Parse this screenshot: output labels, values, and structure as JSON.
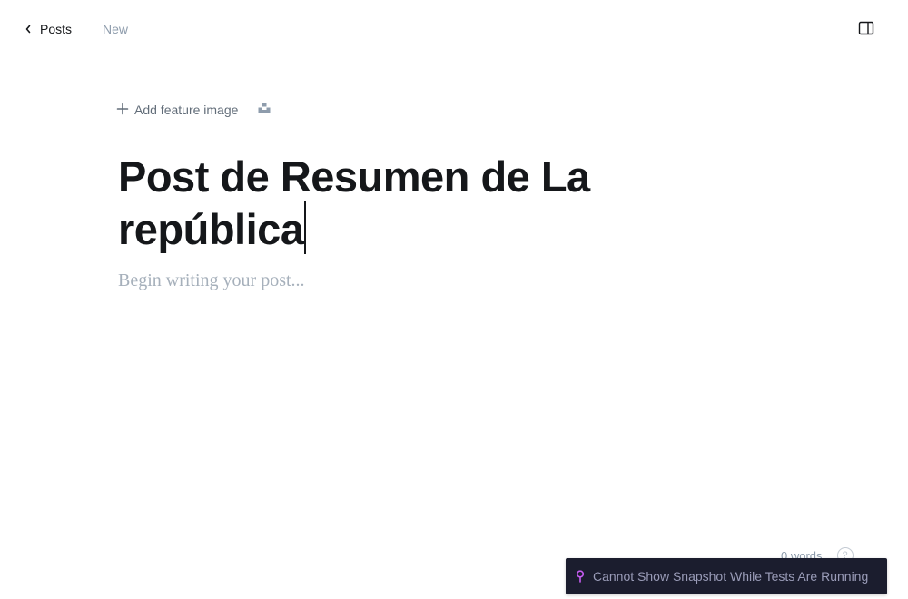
{
  "header": {
    "back_label": "Posts",
    "status": "New",
    "icons": {
      "back": "chevron-left-icon",
      "sidebar": "sidebar-toggle-icon"
    }
  },
  "editor": {
    "add_feature_image_label": "Add feature image",
    "unsplash_icon": "unsplash-icon",
    "title": "Post de Resumen de La república",
    "body_placeholder": "Begin writing your post..."
  },
  "footer": {
    "word_count": "0 words",
    "help_icon": "help-icon"
  },
  "toast": {
    "message": "Cannot Show Snapshot While Tests Are Running",
    "icon": "pin-icon"
  },
  "colors": {
    "text": "#15171a",
    "muted": "#8e9cac",
    "placeholder": "#a6b0bb",
    "toast_bg": "#1b1d2e",
    "toast_text": "#9a9cb8",
    "toast_icon": "#c75cf2"
  }
}
